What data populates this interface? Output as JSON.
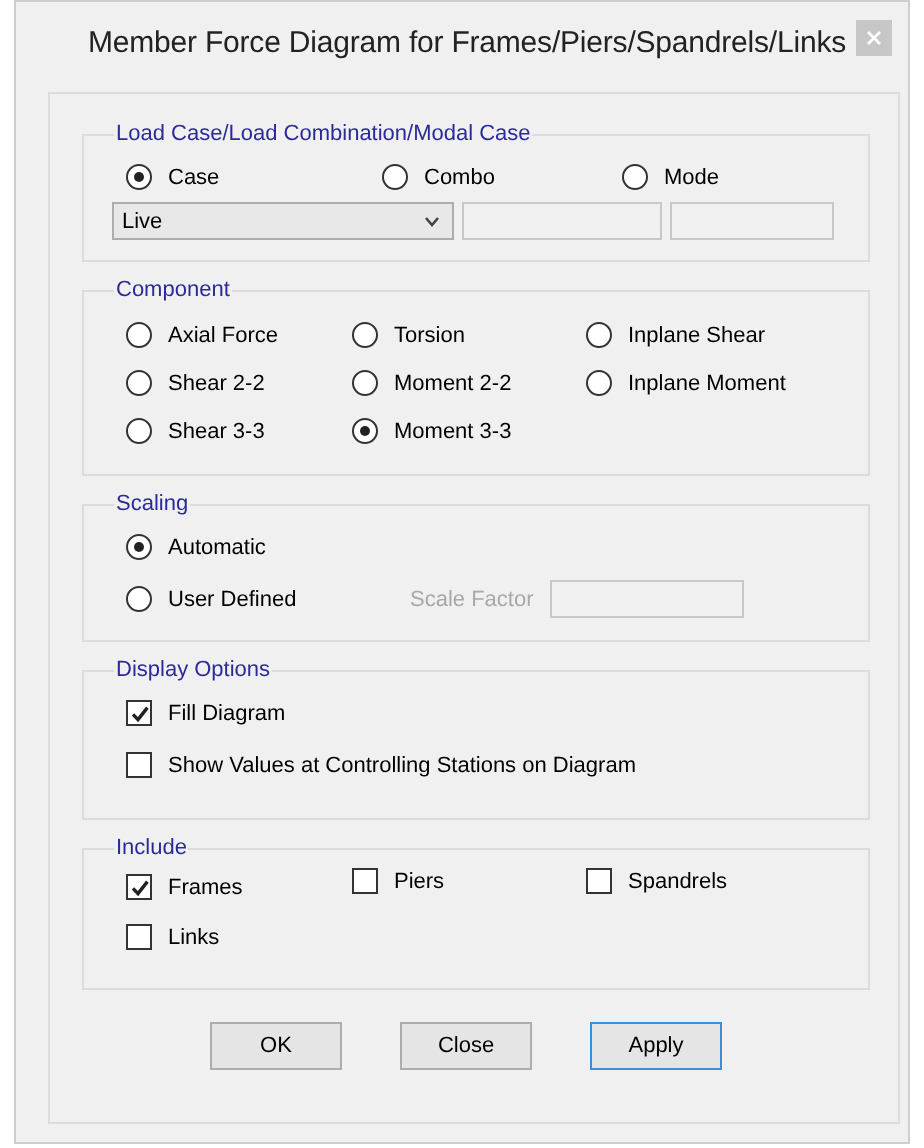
{
  "window": {
    "title": "Member Force Diagram for Frames/Piers/Spandrels/Links"
  },
  "load_case": {
    "title": "Load Case/Load Combination/Modal Case",
    "options": [
      {
        "label": "Case",
        "selected": true
      },
      {
        "label": "Combo",
        "selected": false
      },
      {
        "label": "Mode",
        "selected": false
      }
    ],
    "case_select": {
      "value": "Live"
    }
  },
  "component": {
    "title": "Component",
    "options": [
      {
        "label": "Axial Force",
        "selected": false
      },
      {
        "label": "Torsion",
        "selected": false
      },
      {
        "label": "Inplane Shear",
        "selected": false
      },
      {
        "label": "Shear 2-2",
        "selected": false
      },
      {
        "label": "Moment 2-2",
        "selected": false
      },
      {
        "label": "Inplane Moment",
        "selected": false
      },
      {
        "label": "Shear 3-3",
        "selected": false
      },
      {
        "label": "Moment 3-3",
        "selected": true
      }
    ]
  },
  "scaling": {
    "title": "Scaling",
    "options": [
      {
        "label": "Automatic",
        "selected": true
      },
      {
        "label": "User Defined",
        "selected": false
      }
    ],
    "scale_factor": {
      "label": "Scale Factor",
      "disabled": true
    }
  },
  "display_options": {
    "title": "Display Options",
    "options": [
      {
        "label": "Fill Diagram",
        "checked": true
      },
      {
        "label": "Show Values at Controlling Stations on Diagram",
        "checked": false
      }
    ]
  },
  "include": {
    "title": "Include",
    "options": [
      {
        "label": "Frames",
        "checked": true
      },
      {
        "label": "Piers",
        "checked": false
      },
      {
        "label": "Spandrels",
        "checked": false
      },
      {
        "label": "Links",
        "checked": false
      }
    ]
  },
  "buttons": [
    {
      "label": "OK",
      "default": false
    },
    {
      "label": "Close",
      "default": false
    },
    {
      "label": "Apply",
      "default": true
    }
  ]
}
